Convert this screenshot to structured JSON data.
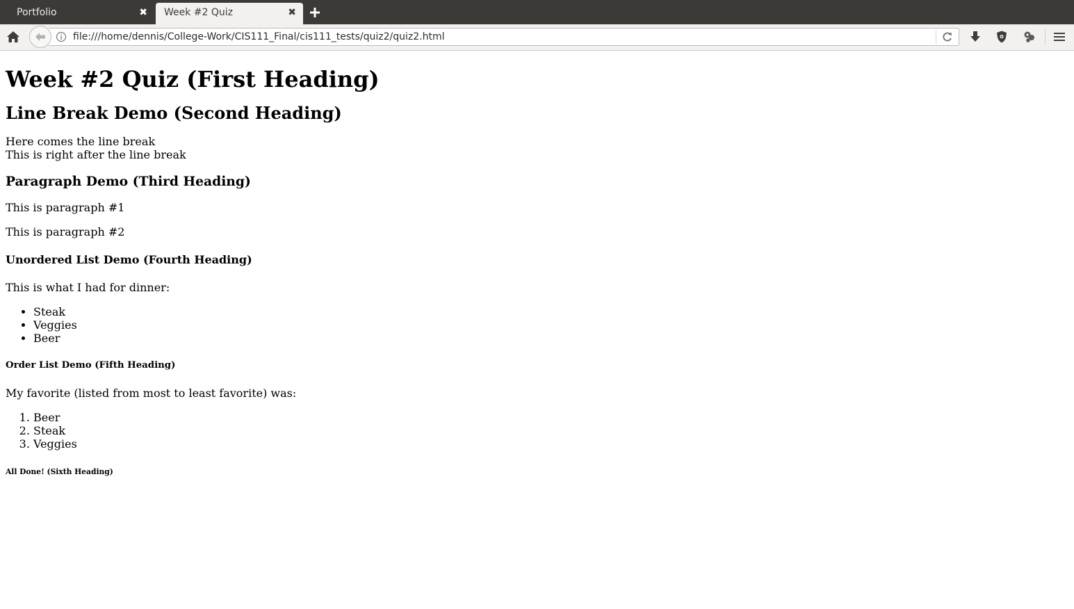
{
  "browser": {
    "tabs": [
      {
        "title": "Portfolio",
        "close": "✖",
        "active": false
      },
      {
        "title": "Week #2 Quiz",
        "close": "✖",
        "active": true
      }
    ],
    "new_tab_icon": "plus-icon",
    "url": "file:///home/dennis/College-Work/CIS111_Final/cis111_tests/quiz2/quiz2.html",
    "toolbar_icons": [
      "home-icon",
      "back-arrow-icon",
      "info-icon",
      "reload-icon",
      "download-icon",
      "shield-icon",
      "extension-icon",
      "hamburger-menu-icon"
    ],
    "colors": {
      "tab_strip": "#3b3a37",
      "toolbar": "#f2f1f0",
      "active_tab": "#f2f1f0"
    }
  },
  "page": {
    "h1": "Week #2 Quiz (First Heading)",
    "h2": "Line Break Demo (Second Heading)",
    "line_break_before": "Here comes the line break",
    "line_break_after": "This is right after the line break",
    "h3": "Paragraph Demo (Third Heading)",
    "paragraph_1": "This is paragraph #1",
    "paragraph_2": "This is paragraph #2",
    "h4": "Unordered List Demo (Fourth Heading)",
    "dinner_intro": "This is what I had for dinner:",
    "dinner_items": [
      "Steak",
      "Veggies",
      "Beer"
    ],
    "h5": "Order List Demo (Fifth Heading)",
    "favorite_intro": "My favorite (listed from most to least favorite) was:",
    "favorite_items": [
      "Beer",
      "Steak",
      "Veggies"
    ],
    "h6": "All Done! (Sixth Heading)"
  }
}
